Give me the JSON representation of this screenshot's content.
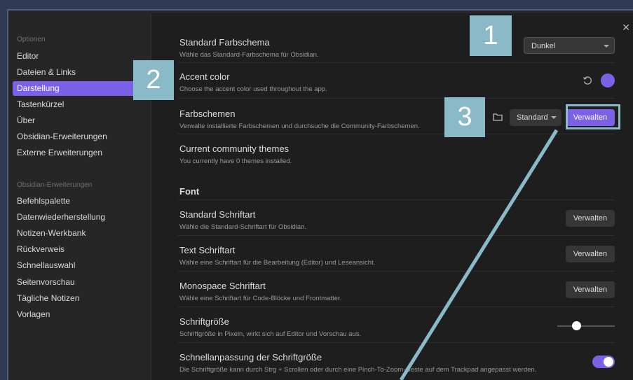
{
  "colors": {
    "accent": "#7b61e8",
    "callout": "#8ab9c7",
    "background": "#1e1e1e",
    "sidebar": "#262626"
  },
  "sidebar": {
    "section1_title": "Optionen",
    "section1_items": [
      {
        "label": "Editor",
        "active": false
      },
      {
        "label": "Dateien & Links",
        "active": false
      },
      {
        "label": "Darstellung",
        "active": true
      },
      {
        "label": "Tastenkürzel",
        "active": false
      },
      {
        "label": "Über",
        "active": false
      },
      {
        "label": "Obsidian-Erweiterungen",
        "active": false
      },
      {
        "label": "Externe Erweiterungen",
        "active": false
      }
    ],
    "section2_title": "Obsidian-Erweiterungen",
    "section2_items": [
      {
        "label": "Befehlspalette"
      },
      {
        "label": "Datenwiederherstellung"
      },
      {
        "label": "Notizen-Werkbank"
      },
      {
        "label": "Rückverweis"
      },
      {
        "label": "Schnellauswahl"
      },
      {
        "label": "Seitenvorschau"
      },
      {
        "label": "Tägliche Notizen"
      },
      {
        "label": "Vorlagen"
      }
    ]
  },
  "settings": {
    "base_theme": {
      "title": "Standard Farbschema",
      "desc": "Wähle das Standard-Farbschema für Obsidian.",
      "value": "Dunkel"
    },
    "accent": {
      "title": "Accent color",
      "desc": "Choose the accent color used throughout the app.",
      "color": "#7b61e8",
      "reset_icon": "reset-icon"
    },
    "themes": {
      "title": "Farbschemen",
      "desc": "Verwalte installierte Farbschemen und durchsuche die Community-Farbschemen.",
      "folder_icon": "folder-icon",
      "dropdown_value": "Standard",
      "button": "Verwalten"
    },
    "community": {
      "title": "Current community themes",
      "desc": "You currently have 0 themes installed."
    },
    "font_heading": "Font",
    "std_font": {
      "title": "Standard Schriftart",
      "desc": "Wähle die Standard-Schriftart für Obsidian.",
      "button": "Verwalten"
    },
    "text_font": {
      "title": "Text Schriftart",
      "desc": "Wähle eine Schriftart für die Bearbeitung (Editor) und Leseansicht.",
      "button": "Verwalten"
    },
    "mono_font": {
      "title": "Monospace Schriftart",
      "desc": "Wähle eine Schriftart für Code-Blöcke und Frontmatter.",
      "button": "Verwalten"
    },
    "font_size": {
      "title": "Schriftgröße",
      "desc": "Schriftgröße in Pixeln, wirkt sich auf Editor und Vorschau aus.",
      "slider_fraction": 0.33
    },
    "quick_font": {
      "title": "Schnellanpassung der Schriftgröße",
      "desc": "Die Schriftgröße kann durch Strg + Scrollen oder durch eine Pinch-To-Zoom-Geste auf dem Trackpad angepasst werden.",
      "enabled": true
    }
  },
  "close_icon": "close-icon",
  "callouts": [
    "1",
    "2",
    "3"
  ]
}
